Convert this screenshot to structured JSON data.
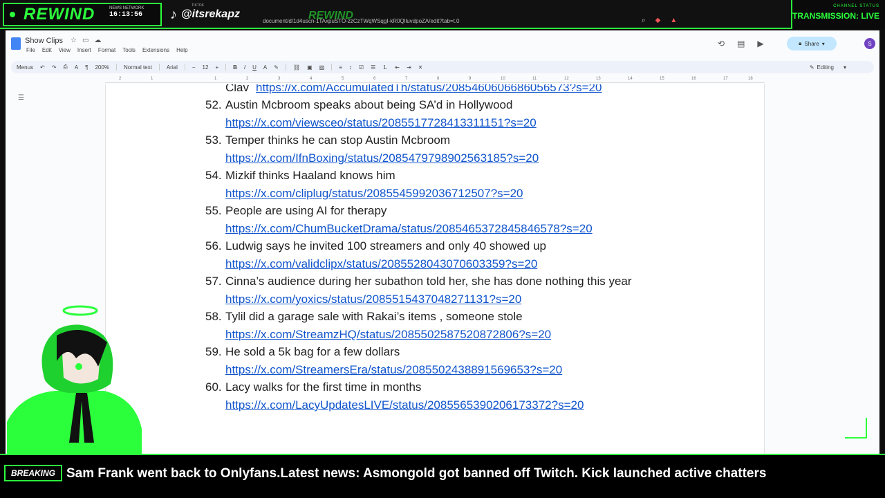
{
  "overlay": {
    "brand": "REWIND",
    "news_network_label": "NEWS NETWORK",
    "clock": "16:13:56",
    "tiktok_label": "TIKTOK",
    "tiktok_handle": "@itsrekapz",
    "url": "document/d/1d4uscn-1TAxpuSTO-zzCzTWqWSqgI-kR0QlluvdpoZA/edit?tab=t.0",
    "watermark": "REWIND",
    "channel_status_label": "CHANNEL STATUS",
    "transmission": "TRANSMISSION: LIVE",
    "accent_color": "#2bff3c"
  },
  "docs": {
    "title": "Show Clips",
    "menu": [
      "File",
      "Edit",
      "View",
      "Insert",
      "Format",
      "Tools",
      "Extensions",
      "Help"
    ],
    "share_label": "Share",
    "avatar_letter": "S",
    "toolbar": {
      "menus": "Menus",
      "zoom": "200%",
      "style": "Normal text",
      "font": "Arial",
      "font_size": "12",
      "editing": "Editing"
    },
    "ruler_marks": [
      "2",
      "1",
      "1",
      "2",
      "3",
      "4",
      "5",
      "6",
      "7",
      "8",
      "9",
      "10",
      "11",
      "12",
      "13",
      "14",
      "15",
      "16",
      "17",
      "18"
    ]
  },
  "clips": {
    "partial_top": {
      "title": "Clav",
      "link": "https://x.com/AccumulatedTh/status/2085460606686056573?s=20"
    },
    "items": [
      {
        "num": "52.",
        "title": "Austin Mcbroom speaks about being SA’d in Hollywood",
        "link": "https://x.com/viewsceo/status/2085517728413311151?s=20"
      },
      {
        "num": "53.",
        "title": "Temper thinks he can stop Austin Mcbroom",
        "link": "https://x.com/IfnBoxing/status/2085479798902563185?s=20"
      },
      {
        "num": "54.",
        "title": "Mizkif thinks Haaland knows him",
        "link": "https://x.com/cliplug/status/2085545992036712507?s=20"
      },
      {
        "num": "55.",
        "title": "People are using AI for therapy",
        "link": "https://x.com/ChumBucketDrama/status/2085465372845846578?s=20"
      },
      {
        "num": "56.",
        "title": "Ludwig says he invited 100 streamers and only 40 showed up",
        "link": "https://x.com/validclipx/status/2085528043070603359?s=20"
      },
      {
        "num": "57.",
        "title": "Cinna’s audience during her subathon told her, she has done nothing this year",
        "link": "https://x.com/yoxics/status/2085515437048271131?s=20"
      },
      {
        "num": "58.",
        "title": "Tylil did a garage sale with Rakai’s items , someone stole",
        "link": "https://x.com/StreamzHQ/status/2085502587520872806?s=20"
      },
      {
        "num": "59.",
        "title": "He sold a 5k bag for a few dollars",
        "link": "https://x.com/StreamersEra/status/2085502438891569653?s=20"
      },
      {
        "num": "60.",
        "title": "Lacy walks for the first time in months",
        "link": "https://x.com/LacyUpdatesLIVE/status/2085565390206173372?s=20"
      }
    ]
  },
  "ticker": {
    "label": "BREAKING",
    "text": "Sam Frank went back to Onlyfans.Latest news:  Asmongold got banned off Twitch. Kick launched active chatters"
  }
}
